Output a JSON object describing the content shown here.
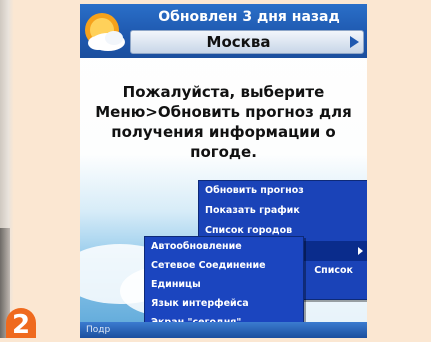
{
  "header": {
    "updated": "Обновлен 3 дня назад",
    "city": "Москва"
  },
  "message": "Пожалуйста, выберите Меню>Обновить прогноз для получения информации о погоде.",
  "main_menu": {
    "items": [
      "Обновить прогноз",
      "Показать график",
      "Список городов",
      "",
      "Список"
    ]
  },
  "sub_menu": {
    "items": [
      "Автообновление",
      "Сетевое Соединение",
      "Единицы",
      "Язык интерфейса",
      "Экран \"сегодня\""
    ]
  },
  "bottom_bar": {
    "left_label": "Подр"
  },
  "step_number": "2",
  "colors": {
    "page_bg": "#fbe7d2",
    "header_blue": "#1f59b0",
    "menu_blue": "#1a43b8",
    "step_orange": "#ef6a1e"
  },
  "icons": {
    "logo": "weather-sun-cloud-logo",
    "city_arrow": "arrow-right-icon",
    "submenu_arrow": "submenu-arrow-icon"
  }
}
